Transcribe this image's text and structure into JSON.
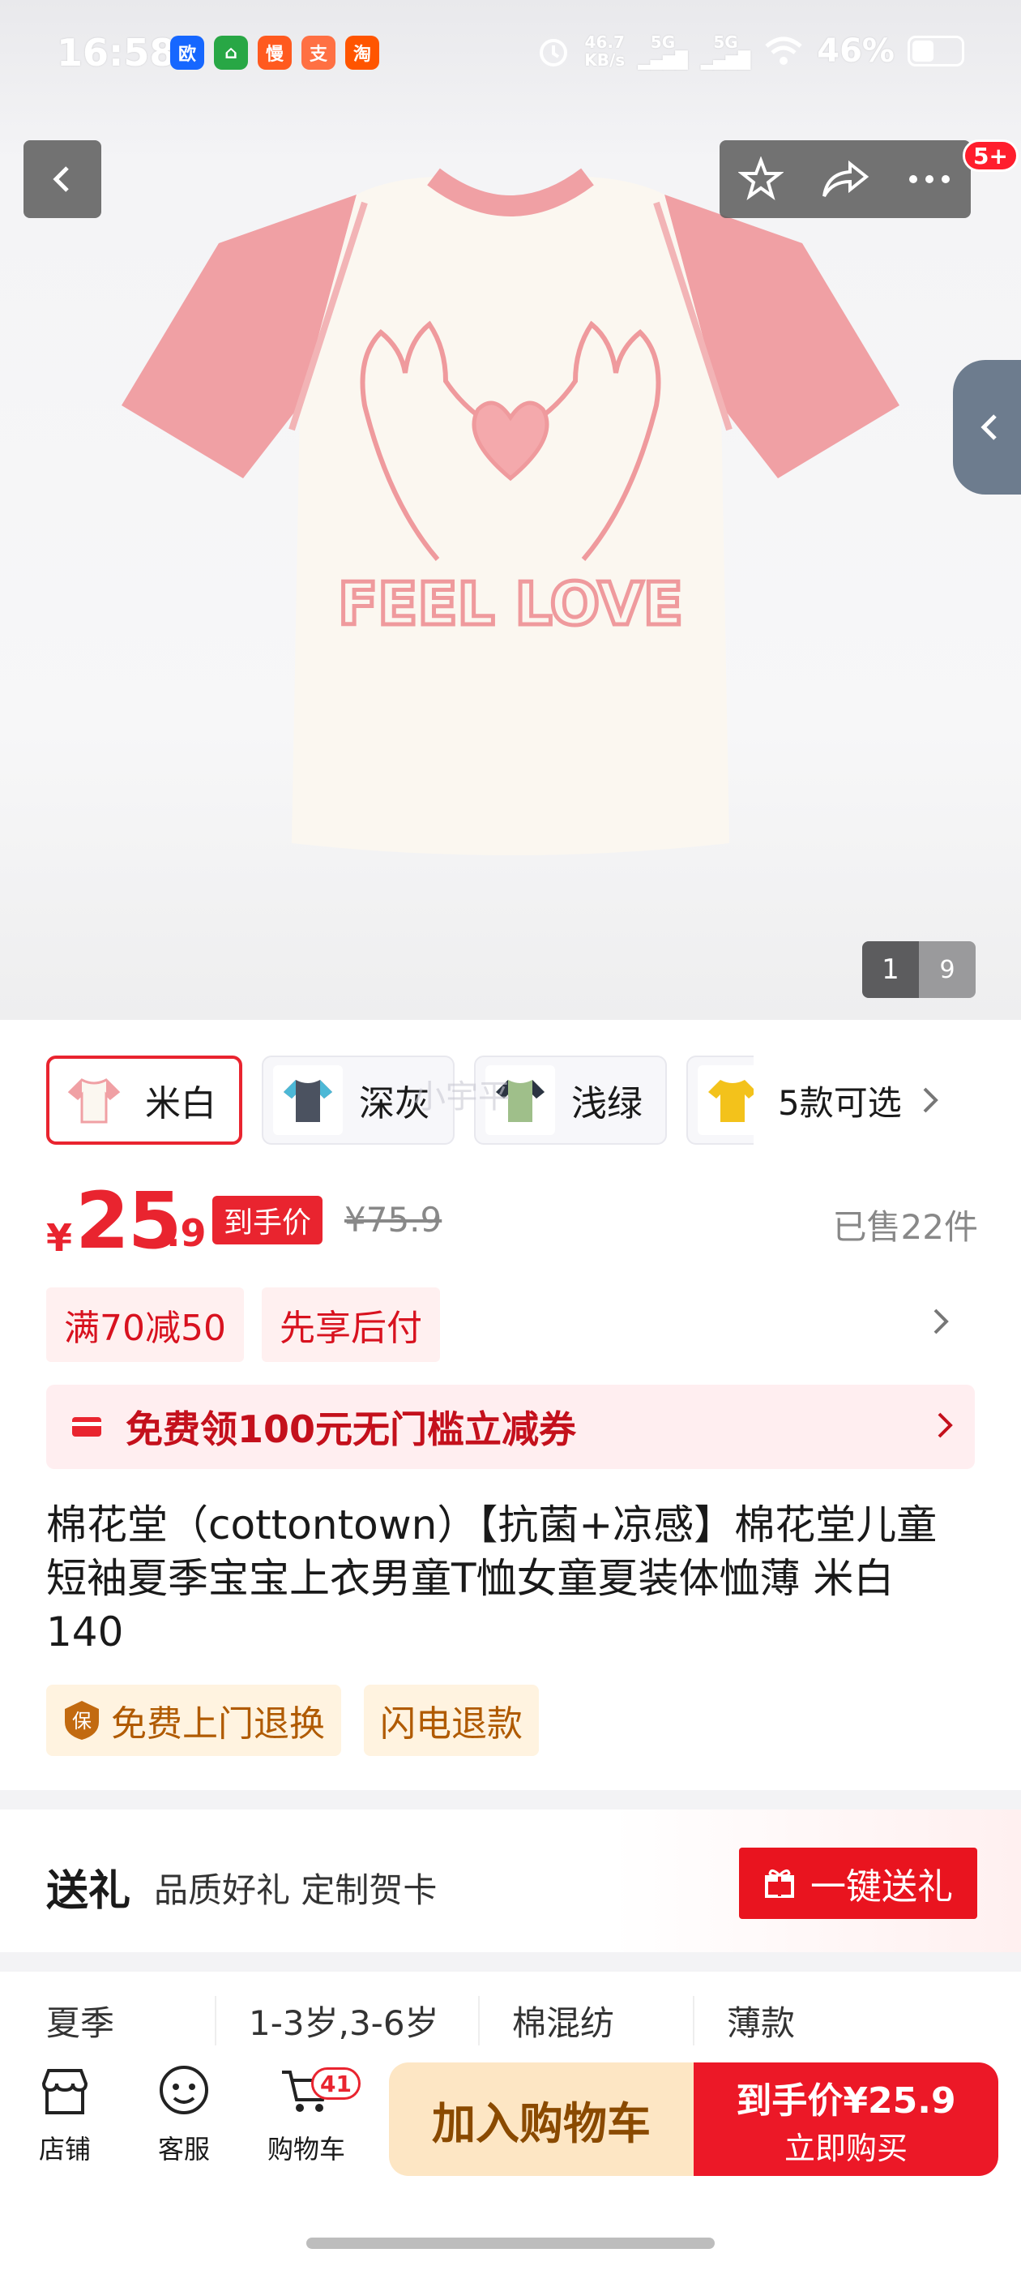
{
  "status_bar": {
    "time": "16:58",
    "apps": [
      {
        "label": "欧",
        "color": "#1667ff"
      },
      {
        "label": "⌂",
        "color": "#28a745"
      },
      {
        "label": "慢",
        "color": "#ff5a1f"
      },
      {
        "label": "支",
        "color": "#ff7043"
      },
      {
        "label": "淘",
        "color": "#ff5500"
      }
    ],
    "net_speed": "46.7",
    "net_unit": "KB/s",
    "signal_1": "5G",
    "signal_2": "5G",
    "battery": "46%"
  },
  "nav": {
    "back_icon": "chevron-left-icon",
    "badge": "5+"
  },
  "gallery": {
    "current": "1",
    "total": "9",
    "print_text": "FEEL LOVE"
  },
  "skus": [
    {
      "name": "米白",
      "selected": true
    },
    {
      "name": "深灰",
      "selected": false
    },
    {
      "name": "浅绿",
      "selected": false
    }
  ],
  "sku_more": "5款可选",
  "watermark": "小宇平",
  "price": {
    "currency": "¥",
    "integer": "25",
    "decimal": ".9",
    "tag": "到手价",
    "original": "¥75.9",
    "sold": "已售22件"
  },
  "promos": [
    "满70减50",
    "先享后付"
  ],
  "coupon": "免费领100元无门槛立减券",
  "title": "棉花堂（cottontown）【抗菌+凉感】棉花堂儿童短袖夏季宝宝上衣男童T恤女童夏装体恤薄 米白 140",
  "services": [
    {
      "icon": "保",
      "label": "免费上门退换"
    },
    {
      "label": "闪电退款"
    }
  ],
  "gift": {
    "title": "送礼",
    "subtitle": "品质好礼 定制贺卡",
    "button": "一键送礼"
  },
  "attributes": [
    "夏季",
    "1-3岁,3-6岁",
    "棉混纺",
    "薄款"
  ],
  "bottom": {
    "tabs": [
      {
        "label": "店铺"
      },
      {
        "label": "客服"
      },
      {
        "label": "购物车"
      }
    ],
    "cart_count": "41",
    "add_cart": "加入购物车",
    "buy_price": "到手价¥25.9",
    "buy_label": "立即购买"
  },
  "colors": {
    "accent": "#e9242f",
    "pink": "#f0a0a4"
  }
}
